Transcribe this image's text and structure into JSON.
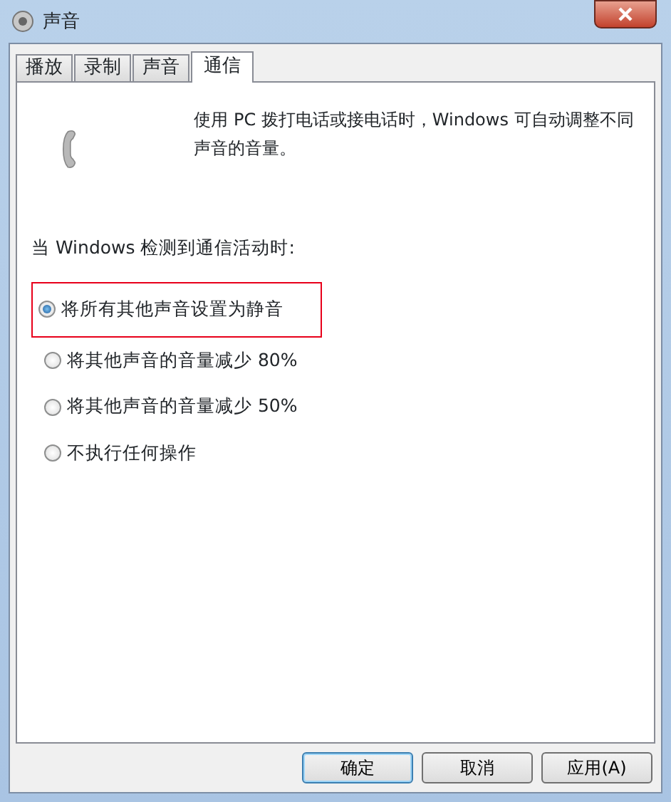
{
  "window": {
    "title": "声音"
  },
  "tabs": [
    {
      "label": "播放",
      "selected": false
    },
    {
      "label": "录制",
      "selected": false
    },
    {
      "label": "声音",
      "selected": false
    },
    {
      "label": "通信",
      "selected": true
    }
  ],
  "description": "使用 PC 拨打电话或接电话时，Windows 可自动调整不同声音的音量。",
  "prompt": "当 Windows 检测到通信活动时:",
  "options": [
    {
      "label": "将所有其他声音设置为静音",
      "selected": true,
      "highlighted": true
    },
    {
      "label": "将其他声音的音量减少 80%",
      "selected": false,
      "highlighted": false
    },
    {
      "label": "将其他声音的音量减少 50%",
      "selected": false,
      "highlighted": false
    },
    {
      "label": "不执行任何操作",
      "selected": false,
      "highlighted": false
    }
  ],
  "buttons": [
    {
      "label": "确定",
      "default": true
    },
    {
      "label": "取消",
      "default": false
    },
    {
      "label": "应用(A)",
      "default": false
    }
  ]
}
